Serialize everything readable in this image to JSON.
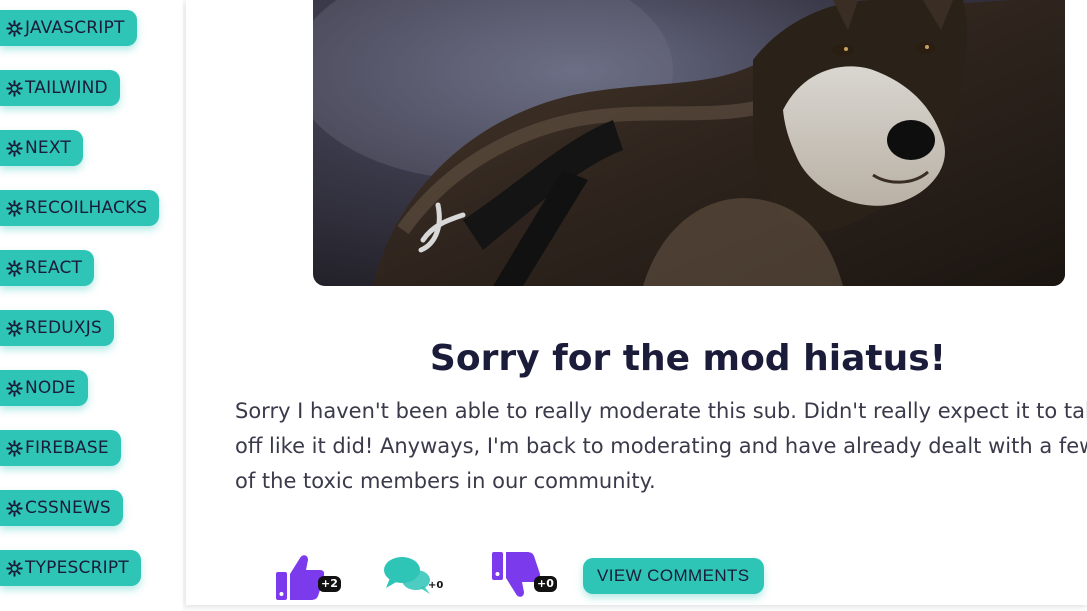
{
  "sidebar": {
    "tags": [
      {
        "label": "JAVASCRIPT",
        "icon": "gear-icon"
      },
      {
        "label": "TAILWIND",
        "icon": "gear-icon"
      },
      {
        "label": "NEXT",
        "icon": "gear-icon"
      },
      {
        "label": "RECOILHACKS",
        "icon": "gear-icon"
      },
      {
        "label": "REACT",
        "icon": "gear-icon"
      },
      {
        "label": "REDUXJS",
        "icon": "gear-icon"
      },
      {
        "label": "NODE",
        "icon": "gear-icon"
      },
      {
        "label": "FIREBASE",
        "icon": "gear-icon"
      },
      {
        "label": "CSSNEWS",
        "icon": "gear-icon"
      },
      {
        "label": "TYPESCRIPT",
        "icon": "gear-icon"
      }
    ]
  },
  "post": {
    "title": "Sorry for the mod hiatus!",
    "body": "Sorry I haven't been able to really moderate this sub. Didn't really expect it to take off like it did! Anyways, I'm back to moderating and have already dealt with a few of the toxic members in our community.",
    "actions": {
      "upvote_count": "+2",
      "comment_count": "+0",
      "downvote_count": "+0",
      "view_comments_label": "VIEW COMMENTS"
    }
  },
  "colors": {
    "accent": "#2ec4b6",
    "vote": "#7c3aed",
    "comment_icon": "#2ec4b6",
    "text_dark": "#1b1b3a"
  }
}
